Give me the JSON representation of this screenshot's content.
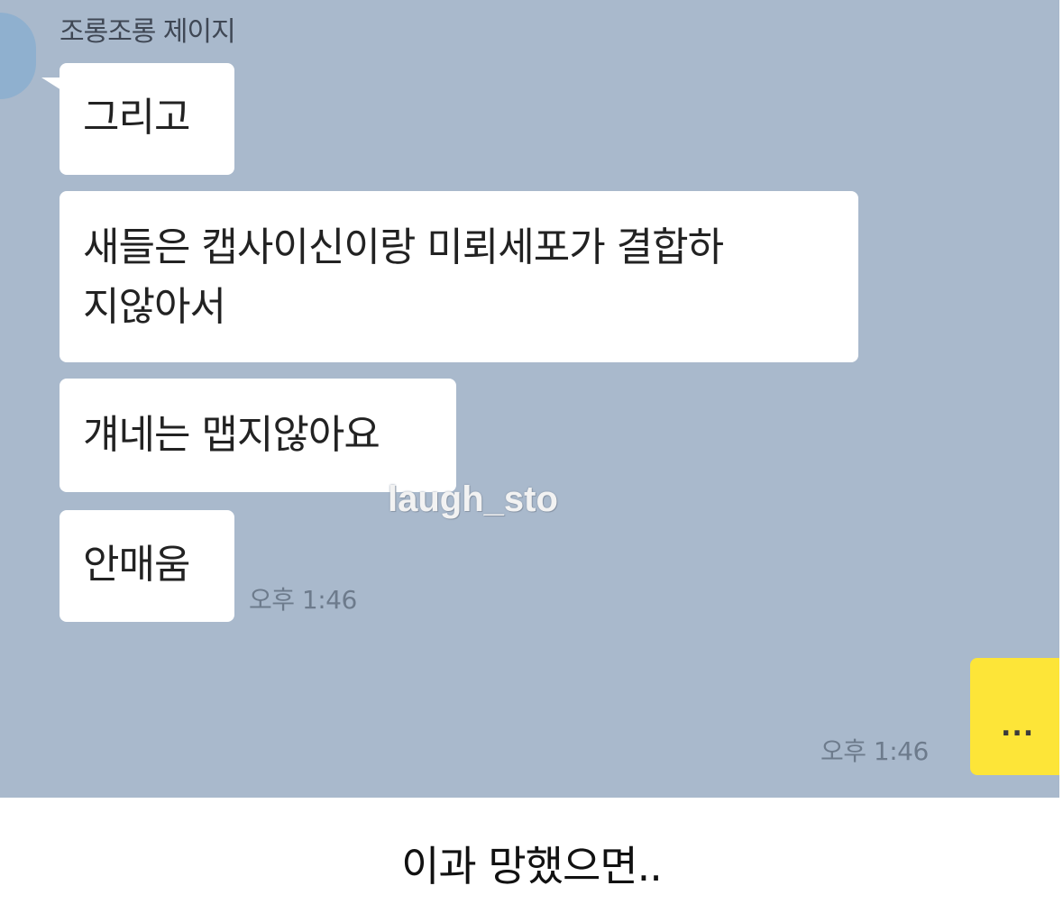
{
  "chat": {
    "sender_name": "조롱조롱 제이지",
    "messages": [
      {
        "text": "그리고"
      },
      {
        "text_line1": "새들은 캡사이신이랑 미뢰세포가 결합하",
        "text_line2": "지않아서"
      },
      {
        "text": "걔네는 맵지않아요"
      },
      {
        "text": "안매움"
      }
    ],
    "received_time": "오후 1:46",
    "sent_message": "...",
    "sent_time": "오후 1:46",
    "colors": {
      "background": "#a9b9cc",
      "received_bubble": "#ffffff",
      "sent_bubble": "#fde538"
    }
  },
  "watermark": "laugh_sto",
  "caption": "이과 망했으면.."
}
